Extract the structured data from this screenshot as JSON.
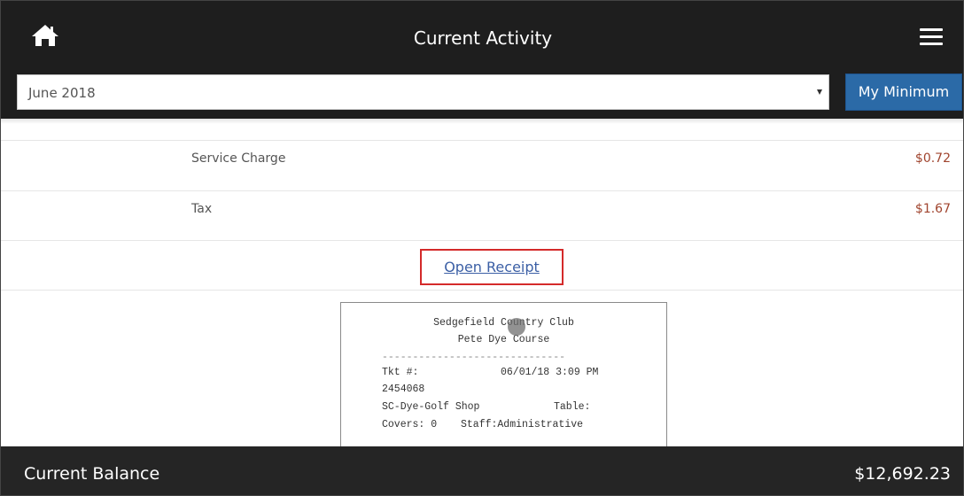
{
  "header": {
    "title": "Current Activity",
    "home_icon": "home-icon",
    "menu_icon": "hamburger-menu-icon"
  },
  "filter": {
    "month_value": "June 2018",
    "minimum_button_label": "My Minimum",
    "accent_color": "#2b6aa7"
  },
  "line_items": [
    {
      "label": "Service Charge",
      "amount": "$0.72"
    },
    {
      "label": "Tax",
      "amount": "$1.67"
    }
  ],
  "receipt_link": {
    "label": "Open Receipt",
    "highlight_color": "#d42a2a"
  },
  "receipt": {
    "club_name": "Sedgefield Country Club",
    "course_name": "Pete Dye Course",
    "divider": "------------------------------",
    "ticket_label": "Tkt #:",
    "ticket_datetime": "06/01/18 3:09 PM",
    "ticket_number": "2454068",
    "location": "SC-Dye-Golf Shop",
    "table_label": "Table:",
    "covers": "Covers: 0",
    "staff": "Staff:Administrative"
  },
  "footer": {
    "balance_label": "Current Balance",
    "balance_value": "$12,692.23"
  },
  "amount_color": "#a0442e"
}
